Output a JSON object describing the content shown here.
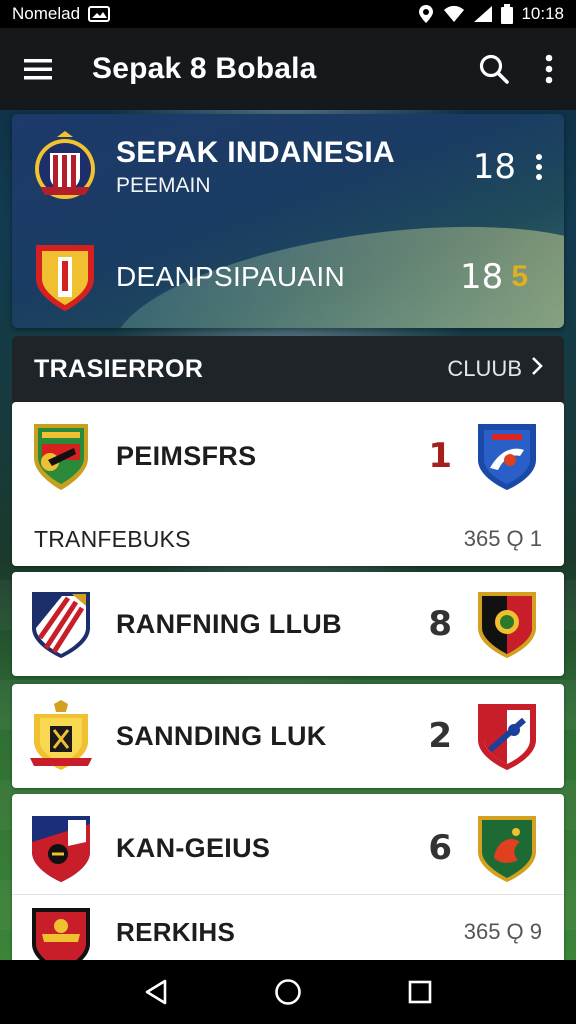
{
  "status_bar": {
    "carrier": "Nomelad",
    "time": "10:18",
    "icons": [
      "image-icon",
      "location-icon",
      "wifi-icon",
      "signal-icon",
      "battery-icon"
    ]
  },
  "app_bar": {
    "title": "Sepak 8 Bobala",
    "icons": [
      "menu-icon",
      "search-icon",
      "more-vert-icon"
    ]
  },
  "hero": {
    "rows": [
      {
        "title": "SEPAK INDANESIA",
        "subtitle": "PEEMAIN",
        "score": "18",
        "crest_colors": [
          "#b21e2b",
          "#1d2f6b",
          "#f2c230"
        ]
      },
      {
        "title": "DEANPSIPAUAIN",
        "subtitle": "",
        "score": "18",
        "score_icon": "5",
        "crest_colors": [
          "#d32020",
          "#f0c030",
          "#ffffff"
        ]
      }
    ]
  },
  "transfers": {
    "title": "TRASIERROR",
    "link_label": "CLUUB",
    "items": [
      {
        "name": "PEIMSFRS",
        "score": "1",
        "score_color": "#a3201c",
        "sub_label": "TRANFEBUKS",
        "sub_value": "365 Ǫ 1"
      },
      {
        "name": "RANFNING LLUB",
        "score": "8"
      },
      {
        "name": "SANNDING LUK",
        "score": "2"
      },
      {
        "name": "KAN-GEIUS",
        "score": "6",
        "sub_label": "RERKIHS",
        "sub_value": "365 Ǫ 9"
      }
    ]
  },
  "colors": {
    "app_bar": "#15191c",
    "section_head": "#1f2429",
    "accent_red": "#a3201c"
  }
}
